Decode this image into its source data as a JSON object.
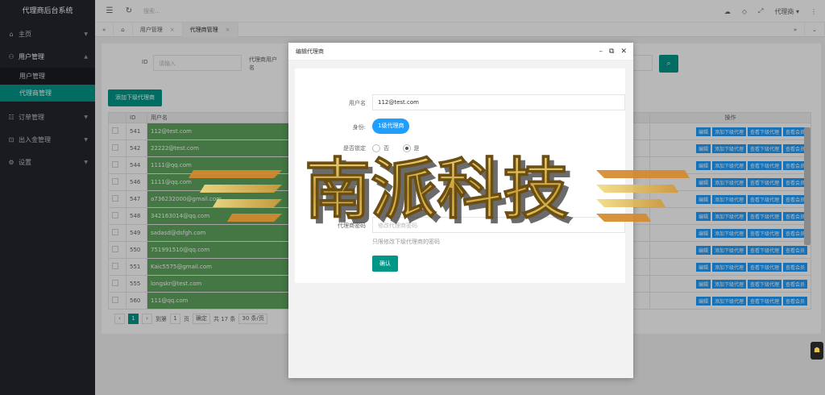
{
  "app": {
    "title": "代理商后台系统"
  },
  "sidebar": {
    "items": [
      {
        "label": "主页",
        "icon": "home-icon"
      },
      {
        "label": "用户管理",
        "icon": "user-icon"
      },
      {
        "label": "订单管理",
        "icon": "order-icon"
      },
      {
        "label": "出入金管理",
        "icon": "money-icon"
      },
      {
        "label": "设置",
        "icon": "settings-icon"
      }
    ],
    "subitems": [
      "用户管理",
      "代理商管理"
    ]
  },
  "topbar": {
    "search_placeholder": "搜索...",
    "user": "代理商 ▾"
  },
  "tabs": [
    "用户管理",
    "代理商管理"
  ],
  "filter": {
    "id_label": "ID",
    "id_placeholder": "请输入",
    "name_label": "代理商用户名"
  },
  "add_button": "添加下级代理商",
  "table": {
    "headers": {
      "id": "ID",
      "username": "用户名",
      "ops": "操作"
    },
    "rows": [
      {
        "id": "541",
        "user": "112@test.com"
      },
      {
        "id": "542",
        "user": "22222@test.com"
      },
      {
        "id": "544",
        "user": "1111@qq.com"
      },
      {
        "id": "546",
        "user": "1111@qq.com"
      },
      {
        "id": "547",
        "user": "a736232000@gmail.com"
      },
      {
        "id": "548",
        "user": "342163014@qq.com"
      },
      {
        "id": "549",
        "user": "sadasd@dsfgh.com"
      },
      {
        "id": "550",
        "user": "751991510@qq.com"
      },
      {
        "id": "551",
        "user": "Kaic5575@gmail.com"
      },
      {
        "id": "555",
        "user": "longskr@test.com"
      },
      {
        "id": "560",
        "user": "111@qq.com"
      }
    ],
    "ops": [
      "编辑",
      "添加下级代理",
      "查看下级代理",
      "查看会员"
    ]
  },
  "pager": {
    "prefix": "到第",
    "page": "1",
    "suffix": "页",
    "go": "确定",
    "total": "共 17 条",
    "size": "30 条/页"
  },
  "modal": {
    "title": "编辑代理商",
    "username_label": "用户名",
    "username_value": "112@test.com",
    "identity_label": "身份:",
    "identity_value": "1级代理商",
    "lock_label": "是否锁定",
    "lock_no": "否",
    "lock_yes": "是",
    "password_label": "代理商密码",
    "password_placeholder": "修改代理商密码",
    "password_hint": "只限修改下级代理商的密码",
    "confirm": "确认"
  },
  "watermark": {
    "text": "南派科技"
  },
  "colors": {
    "accent": "#009688",
    "blue": "#1e9fff",
    "sidebar": "#23262e"
  }
}
